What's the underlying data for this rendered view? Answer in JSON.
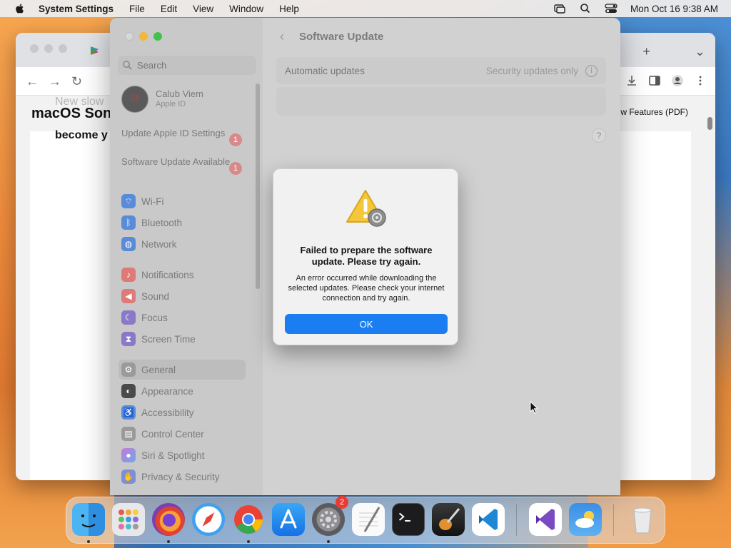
{
  "menubar": {
    "app_name": "System Settings",
    "menus": [
      "File",
      "Edit",
      "View",
      "Window",
      "Help"
    ],
    "datetime": "Mon Oct 16  9:38 AM"
  },
  "browser": {
    "heading": "macOS Son",
    "subheading": "become y",
    "faded_text": "New slow",
    "pdf_link": "w Features (PDF)"
  },
  "settings": {
    "search_placeholder": "Search",
    "user": {
      "name": "Calub Viem",
      "subtitle": "Apple ID"
    },
    "notices": [
      {
        "label": "Update Apple ID Settings",
        "count": "1"
      },
      {
        "label": "Software Update Available",
        "count": "1"
      }
    ],
    "items": [
      {
        "label": "Wi-Fi",
        "color": "#5a8bd8"
      },
      {
        "label": "Bluetooth",
        "color": "#5a8bd8"
      },
      {
        "label": "Network",
        "color": "#5a8bd8"
      },
      {
        "label": "Notifications",
        "color": "#de7a78"
      },
      {
        "label": "Sound",
        "color": "#de7a78"
      },
      {
        "label": "Focus",
        "color": "#8a78c9"
      },
      {
        "label": "Screen Time",
        "color": "#8a78c9"
      },
      {
        "label": "General",
        "color": "#9a9a9a"
      },
      {
        "label": "Appearance",
        "color": "#4a4a4a"
      },
      {
        "label": "Accessibility",
        "color": "#5a8bd8"
      },
      {
        "label": "Control Center",
        "color": "#9a9a9a"
      },
      {
        "label": "Siri & Spotlight",
        "color": "#b07ad0"
      },
      {
        "label": "Privacy & Security",
        "color": "#7a8fd8"
      }
    ],
    "selected": "General",
    "page_title": "Software Update",
    "auto_updates_label": "Automatic updates",
    "auto_updates_value": "Security updates only",
    "help": "?"
  },
  "alert": {
    "title": "Failed to prepare the software update. Please try again.",
    "message": "An error occurred while downloading the selected updates. Please check your internet connection and try again.",
    "button": "OK"
  },
  "dock": {
    "items": [
      "Finder",
      "Launchpad",
      "Firefox",
      "Safari",
      "Chrome",
      "App Store",
      "System Settings",
      "TextEdit",
      "Terminal",
      "GarageBand",
      "Visual Studio Code",
      "Visual Studio",
      "Weather",
      "Trash"
    ],
    "settings_badge": "2"
  }
}
